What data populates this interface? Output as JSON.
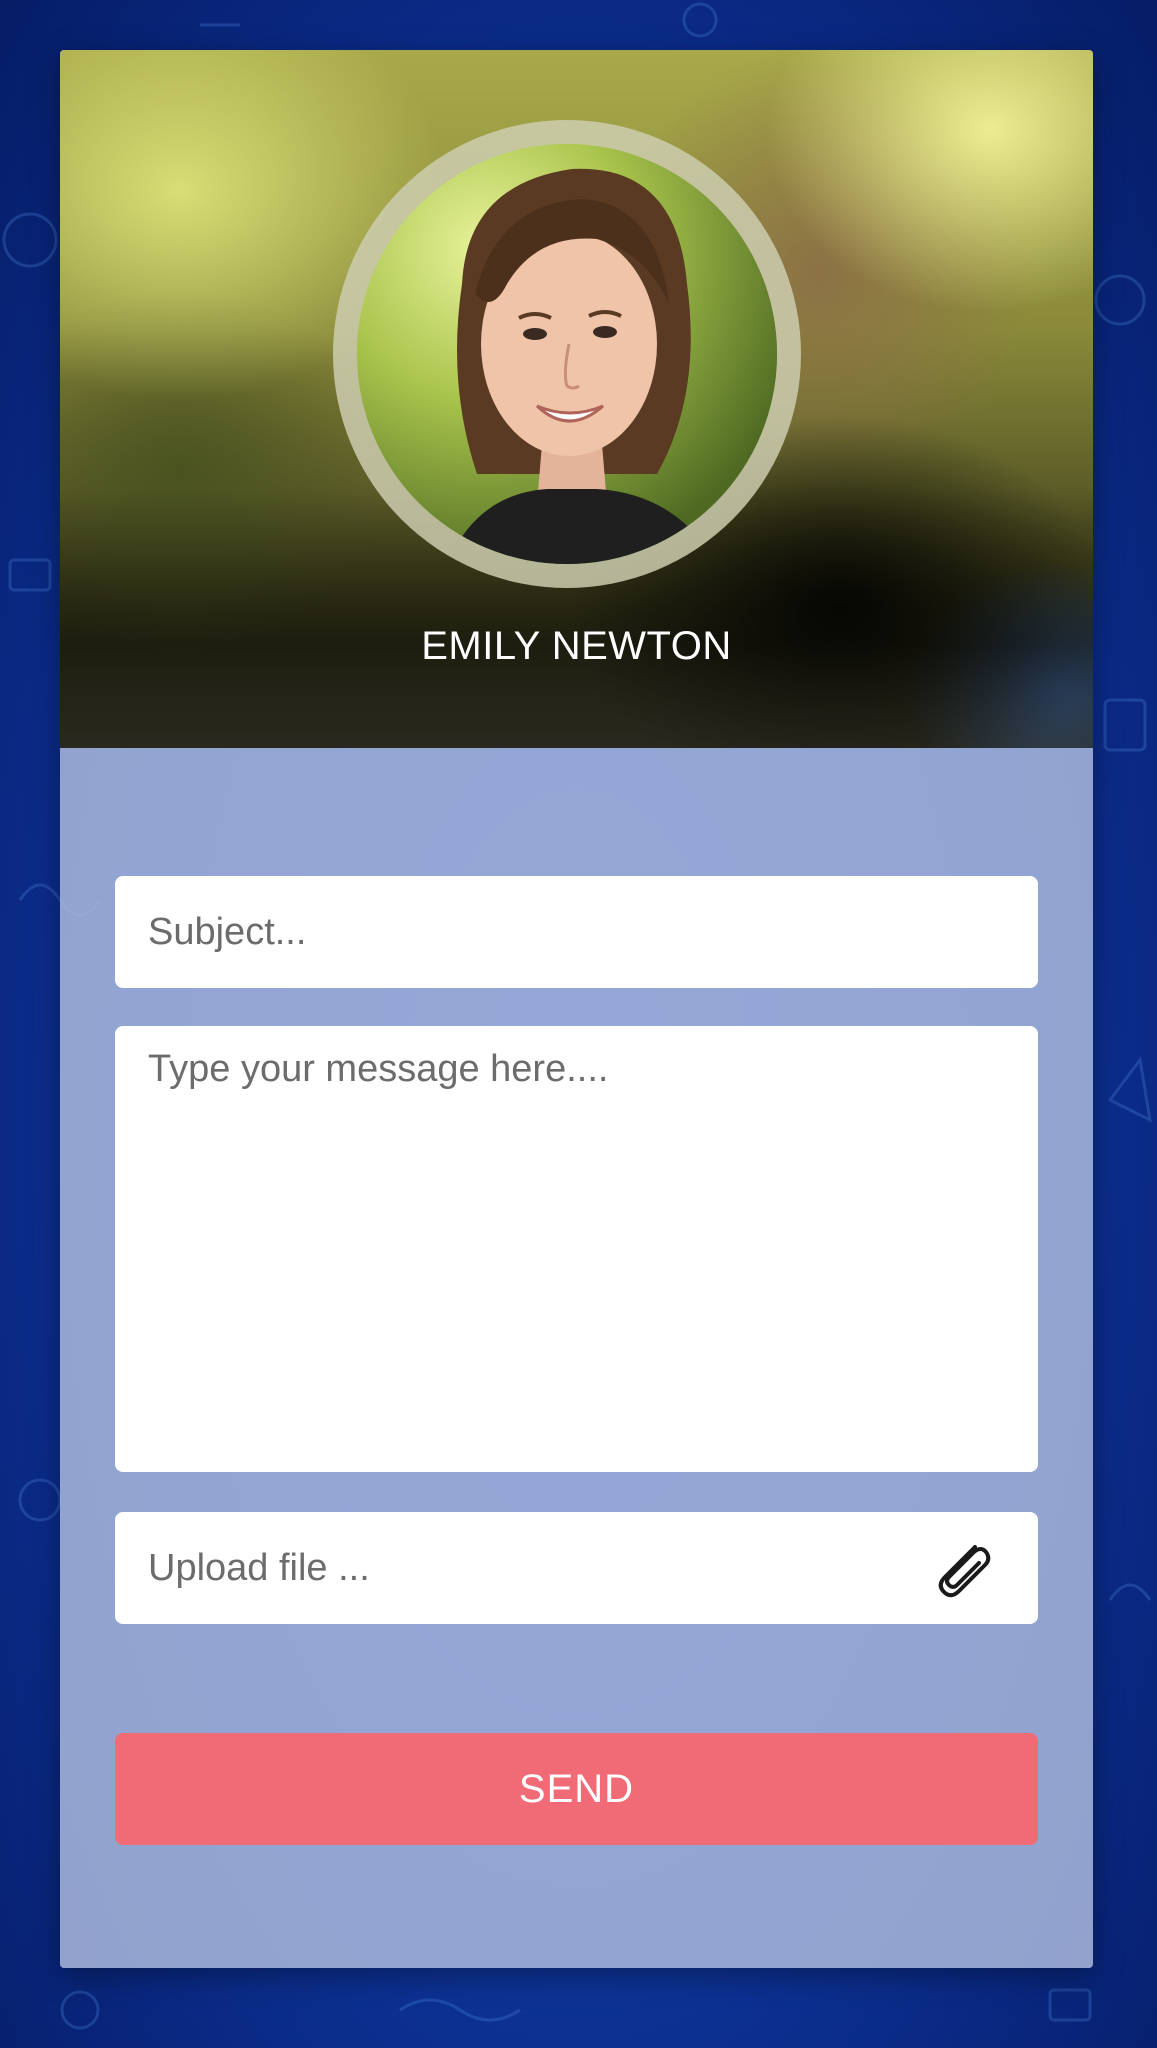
{
  "profile": {
    "name": "EMILY NEWTON"
  },
  "form": {
    "subject_placeholder": "Subject...",
    "message_placeholder": "Type your message here....",
    "upload_placeholder": "Upload file ...",
    "send_label": "SEND"
  },
  "icons": {
    "attach": "paperclip-icon"
  },
  "colors": {
    "send_button": "#f06b75",
    "background": "#0f3aa3",
    "card_body": "#aab9dc"
  }
}
